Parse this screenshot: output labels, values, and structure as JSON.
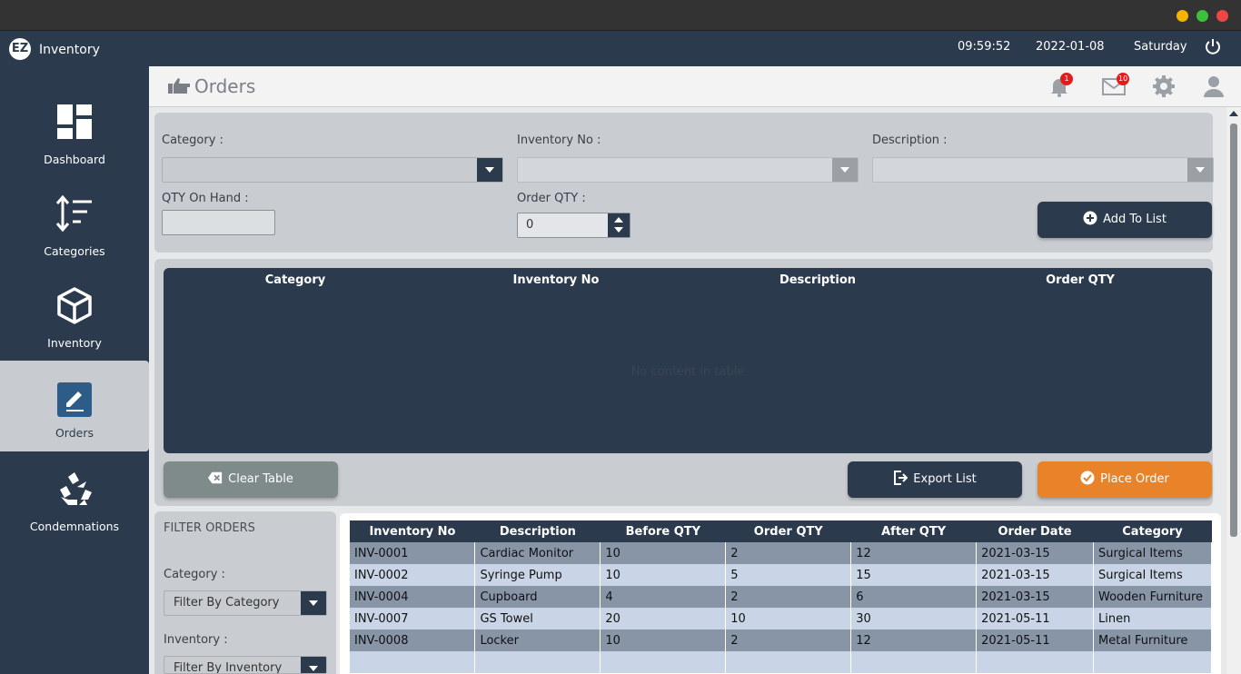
{
  "app": {
    "title": "Inventory",
    "logo_text": "EZ"
  },
  "status": {
    "time": "09:59:52",
    "date": "2022-01-08",
    "day": "Saturday"
  },
  "sidebar": {
    "items": [
      {
        "label": "Dashboard",
        "icon": "dashboard-icon"
      },
      {
        "label": "Categories",
        "icon": "sort-icon"
      },
      {
        "label": "Inventory",
        "icon": "box-icon"
      },
      {
        "label": "Orders",
        "icon": "edit-icon",
        "active": true
      },
      {
        "label": "Condemnations",
        "icon": "recycle-icon"
      }
    ]
  },
  "header": {
    "title": "Orders",
    "notifications": "1",
    "messages": "10"
  },
  "form": {
    "category_label": "Category :",
    "inventory_no_label": "Inventory No :",
    "description_label": "Description :",
    "qty_on_hand_label": "QTY On Hand :",
    "order_qty_label": "Order QTY :",
    "order_qty_value": "0",
    "add_button": "Add To List"
  },
  "list_table": {
    "columns": [
      "Category",
      "Inventory No",
      "Description",
      "Order QTY"
    ],
    "empty_message": "No content in table"
  },
  "actions": {
    "clear": "Clear Table",
    "export": "Export List",
    "place": "Place Order"
  },
  "filter": {
    "title": "FILTER ORDERS",
    "category_label": "Category :",
    "category_value": "Filter By Category",
    "inventory_label": "Inventory :",
    "inventory_value": "Filter By Inventory"
  },
  "orders": {
    "columns": [
      "Inventory No",
      "Description",
      "Before QTY",
      "Order QTY",
      "After QTY",
      "Order Date",
      "Category"
    ],
    "rows": [
      [
        "INV-0001",
        "Cardiac Monitor",
        "10",
        "2",
        "12",
        "2021-03-15",
        "Surgical Items"
      ],
      [
        "INV-0002",
        "Syringe Pump",
        "10",
        "5",
        "15",
        "2021-03-15",
        "Surgical Items"
      ],
      [
        "INV-0004",
        "Cupboard",
        "4",
        "2",
        "6",
        "2021-03-15",
        "Wooden Furniture"
      ],
      [
        "INV-0007",
        "GS Towel",
        "20",
        "10",
        "30",
        "2021-05-11",
        "Linen"
      ],
      [
        "INV-0008",
        "Locker",
        "10",
        "2",
        "12",
        "2021-05-11",
        "Metal Furniture"
      ]
    ]
  },
  "colors": {
    "primary": "#2c3a4e",
    "accent": "#e8832a",
    "clear_button": "#7f8b8b",
    "badge": "#e21b1b"
  }
}
